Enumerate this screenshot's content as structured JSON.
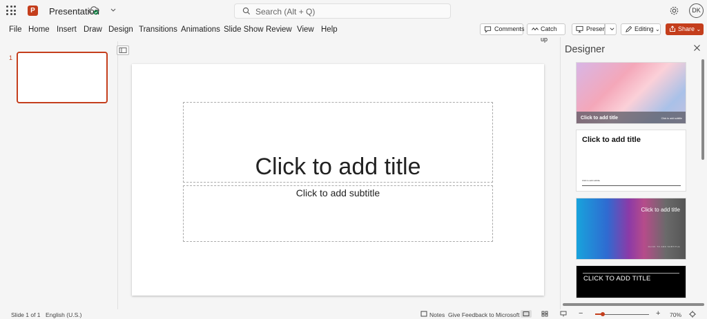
{
  "app": {
    "title": "Presentation",
    "icons": {
      "launcher": "app-launcher-icon",
      "logo": "powerpoint-logo-icon",
      "saved": "cloud-saved-icon"
    }
  },
  "search": {
    "placeholder": "Search (Alt + Q)"
  },
  "user": {
    "initials": "DK"
  },
  "ribbon": {
    "tabs": [
      "File",
      "Home",
      "Insert",
      "Draw",
      "Design",
      "Transitions",
      "Animations",
      "Slide Show",
      "Review",
      "View",
      "Help"
    ],
    "comments": "Comments",
    "catch_up": "Catch up",
    "present": "Present",
    "editing": "Editing",
    "share": "Share"
  },
  "thumbnails": {
    "slide_number": "1"
  },
  "slide": {
    "title_placeholder": "Click to add title",
    "subtitle_placeholder": "Click to add subtitle"
  },
  "designer": {
    "title": "Designer",
    "cards": [
      {
        "title": "Click to add title",
        "subtitle": "Click to add subtitle"
      },
      {
        "title": "Click to add title",
        "subtitle": "Click to add subtitle"
      },
      {
        "title": "Click to add title",
        "subtitle": "CLICK TO ADD SUBTITLE"
      },
      {
        "title": "CLICK TO ADD TITLE"
      }
    ]
  },
  "status": {
    "slide_info": "Slide 1 of 1",
    "language": "English (U.S.)",
    "notes": "Notes",
    "feedback": "Give Feedback to Microsoft",
    "zoom": "70%",
    "zoom_fraction": 0.14
  },
  "colors": {
    "accent": "#c43e1c",
    "background": "#f5f5f5"
  }
}
